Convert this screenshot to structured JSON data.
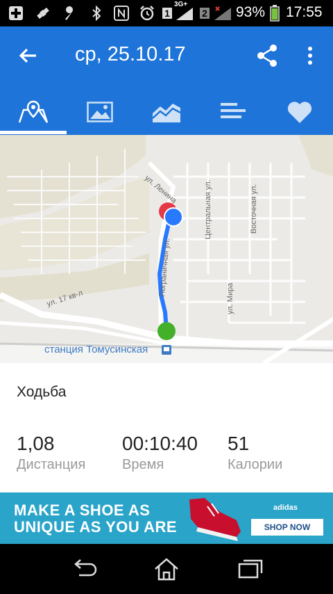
{
  "status_bar": {
    "sim1": "1",
    "network": "3G+",
    "sim2": "2",
    "battery": "93%",
    "time": "17:55"
  },
  "header": {
    "title": "ср, 25.10.17"
  },
  "tabs": [
    {
      "name": "map",
      "active": true
    },
    {
      "name": "photos",
      "active": false
    },
    {
      "name": "charts",
      "active": false
    },
    {
      "name": "splits",
      "active": false
    },
    {
      "name": "heart-rate",
      "active": false
    }
  ],
  "map": {
    "street_lenina": "ул. Ленина",
    "street_centralnaya": "Центральная ул.",
    "street_vostochnaya": "Восточная ул.",
    "street_pogranichnaya": "Пограничная ул.",
    "street_17kvl": "ул. 17 кв-л",
    "street_mira": "ул. Мира",
    "station": "станция Томусинская"
  },
  "workout": {
    "activity": "Ходьба",
    "distance_value": "1,08",
    "distance_label": "Дистанция",
    "time_value": "00:10:40",
    "time_label": "Время",
    "calories_value": "51",
    "calories_label": "Калории"
  },
  "ad": {
    "line1": "MAKE A SHOE AS",
    "line2": "UNIQUE AS YOU ARE",
    "brand": "adidas",
    "button": "SHOP NOW"
  },
  "colors": {
    "appbar": "#1e74d8",
    "route": "#2979ff",
    "start": "#43b02a",
    "finish": "#e53945"
  }
}
